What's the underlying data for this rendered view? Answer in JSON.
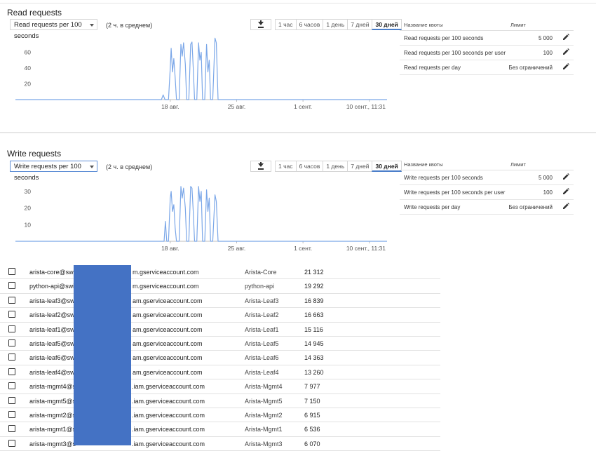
{
  "read_section": {
    "title": "Read requests",
    "select_value": "Read requests per 100 seconds",
    "average_note": "(2 ч. в среднем)",
    "time_ranges": [
      "1 час",
      "6 часов",
      "1 день",
      "7 дней",
      "30 дней"
    ],
    "active_range": "30 дней",
    "quota": {
      "header_name": "Название квоты",
      "header_limit": "Лимит",
      "rows": [
        {
          "name": "Read requests per 100 seconds",
          "limit": "5 000"
        },
        {
          "name": "Read requests per 100 seconds per user",
          "limit": "100"
        },
        {
          "name": "Read requests per day",
          "limit": "Без ограничений"
        }
      ]
    }
  },
  "write_section": {
    "title": "Write requests",
    "select_value": "Write requests per 100 seconds",
    "average_note": "(2 ч. в среднем)",
    "time_ranges": [
      "1 час",
      "6 часов",
      "1 день",
      "7 дней",
      "30 дней"
    ],
    "active_range": "30 дней",
    "quota": {
      "header_name": "Название квоты",
      "header_limit": "Лимит",
      "rows": [
        {
          "name": "Write requests per 100 seconds",
          "limit": "5 000"
        },
        {
          "name": "Write requests per 100 seconds per user",
          "limit": "100"
        },
        {
          "name": "Write requests per day",
          "limit": "Без ограничений"
        }
      ]
    }
  },
  "chart_data": [
    {
      "type": "line",
      "title": "",
      "x_ticks": [
        "18 авг.",
        "25 авг.",
        "1 сент.",
        "10 сент., 11:31"
      ],
      "y_ticks": [
        20,
        40,
        60
      ],
      "ylim": [
        0,
        80
      ],
      "color": "#7ba7e8",
      "series": [
        {
          "points": [
            [
              0,
              0
            ],
            [
              16.5,
              0
            ],
            [
              16.7,
              6
            ],
            [
              16.9,
              0
            ],
            [
              17.3,
              0
            ],
            [
              17.5,
              40
            ],
            [
              17.6,
              65
            ],
            [
              17.75,
              35
            ],
            [
              17.9,
              52
            ],
            [
              18.05,
              28
            ],
            [
              18.2,
              0
            ],
            [
              18.5,
              0
            ],
            [
              18.7,
              70
            ],
            [
              18.85,
              55
            ],
            [
              19.0,
              72
            ],
            [
              19.2,
              45
            ],
            [
              19.35,
              0
            ],
            [
              19.6,
              0
            ],
            [
              19.8,
              70
            ],
            [
              19.95,
              73
            ],
            [
              20.1,
              40
            ],
            [
              20.25,
              0
            ],
            [
              20.5,
              0
            ],
            [
              20.7,
              72
            ],
            [
              20.85,
              50
            ],
            [
              21.0,
              60
            ],
            [
              21.15,
              0
            ],
            [
              21.4,
              0
            ],
            [
              21.6,
              70
            ],
            [
              21.75,
              35
            ],
            [
              21.9,
              50
            ],
            [
              22.05,
              0
            ],
            [
              22.3,
              0
            ],
            [
              22.55,
              78
            ],
            [
              22.7,
              72
            ],
            [
              22.9,
              0
            ],
            [
              42,
              0
            ]
          ]
        }
      ]
    },
    {
      "type": "line",
      "title": "",
      "x_ticks": [
        "18 авг.",
        "25 авг.",
        "1 сент.",
        "10 сент., 11:31"
      ],
      "y_ticks": [
        10,
        20,
        30
      ],
      "ylim": [
        0,
        38
      ],
      "color": "#7ba7e8",
      "series": [
        {
          "points": [
            [
              0,
              0
            ],
            [
              16.8,
              0
            ],
            [
              16.95,
              12
            ],
            [
              17.1,
              0
            ],
            [
              17.3,
              0
            ],
            [
              17.5,
              26
            ],
            [
              17.6,
              30
            ],
            [
              17.75,
              18
            ],
            [
              17.9,
              22
            ],
            [
              18.05,
              8
            ],
            [
              18.2,
              0
            ],
            [
              18.5,
              0
            ],
            [
              18.7,
              33
            ],
            [
              18.85,
              26
            ],
            [
              19.0,
              32
            ],
            [
              19.2,
              20
            ],
            [
              19.35,
              0
            ],
            [
              19.6,
              0
            ],
            [
              19.8,
              33
            ],
            [
              19.95,
              32
            ],
            [
              20.1,
              18
            ],
            [
              20.25,
              0
            ],
            [
              20.5,
              0
            ],
            [
              20.7,
              33
            ],
            [
              20.85,
              24
            ],
            [
              21.0,
              30
            ],
            [
              21.15,
              0
            ],
            [
              21.4,
              0
            ],
            [
              21.6,
              31
            ],
            [
              21.75,
              18
            ],
            [
              21.9,
              26
            ],
            [
              22.05,
              0
            ],
            [
              22.3,
              0
            ],
            [
              22.55,
              28
            ],
            [
              22.7,
              24
            ],
            [
              22.9,
              0
            ],
            [
              42,
              0
            ]
          ]
        }
      ]
    }
  ],
  "service_accounts": [
    {
      "email_prefix": "arista-core@swi",
      "email_suffix": "m.gserviceaccount.com",
      "name": "Arista-Core",
      "count": "21 312"
    },
    {
      "email_prefix": "python-api@swi",
      "email_suffix": "m.gserviceaccount.com",
      "name": "python-api",
      "count": "19 292"
    },
    {
      "email_prefix": "arista-leaf3@sw",
      "email_suffix": "am.gserviceaccount.com",
      "name": "Arista-Leaf3",
      "count": "16 839"
    },
    {
      "email_prefix": "arista-leaf2@sw",
      "email_suffix": "am.gserviceaccount.com",
      "name": "Arista-Leaf2",
      "count": "16 663"
    },
    {
      "email_prefix": "arista-leaf1@sw",
      "email_suffix": "am.gserviceaccount.com",
      "name": "Arista-Leaf1",
      "count": "15 116"
    },
    {
      "email_prefix": "arista-leaf5@sw",
      "email_suffix": "am.gserviceaccount.com",
      "name": "Arista-Leaf5",
      "count": "14 945"
    },
    {
      "email_prefix": "arista-leaf6@sw",
      "email_suffix": "am.gserviceaccount.com",
      "name": "Arista-Leaf6",
      "count": "14 363"
    },
    {
      "email_prefix": "arista-leaf4@sw",
      "email_suffix": "am.gserviceaccount.com",
      "name": "Arista-Leaf4",
      "count": "13 260"
    },
    {
      "email_prefix": "arista-mgmt4@s",
      "email_suffix": ".iam.gserviceaccount.com",
      "name": "Arista-Mgmt4",
      "count": "7 977"
    },
    {
      "email_prefix": "arista-mgmt5@s",
      "email_suffix": ".iam.gserviceaccount.com",
      "name": "Arista-Mgmt5",
      "count": "7 150"
    },
    {
      "email_prefix": "arista-mgmt2@s",
      "email_suffix": ".iam.gserviceaccount.com",
      "name": "Arista-Mgmt2",
      "count": "6 915"
    },
    {
      "email_prefix": "arista-mgmt1@s",
      "email_suffix": ".iam.gserviceaccount.com",
      "name": "Arista-Mgmt1",
      "count": "6 536"
    },
    {
      "email_prefix": "arista-mgmt3@s",
      "email_suffix": ".iam.gserviceaccount.com",
      "name": "Arista-Mgmt3",
      "count": "6 070"
    }
  ]
}
